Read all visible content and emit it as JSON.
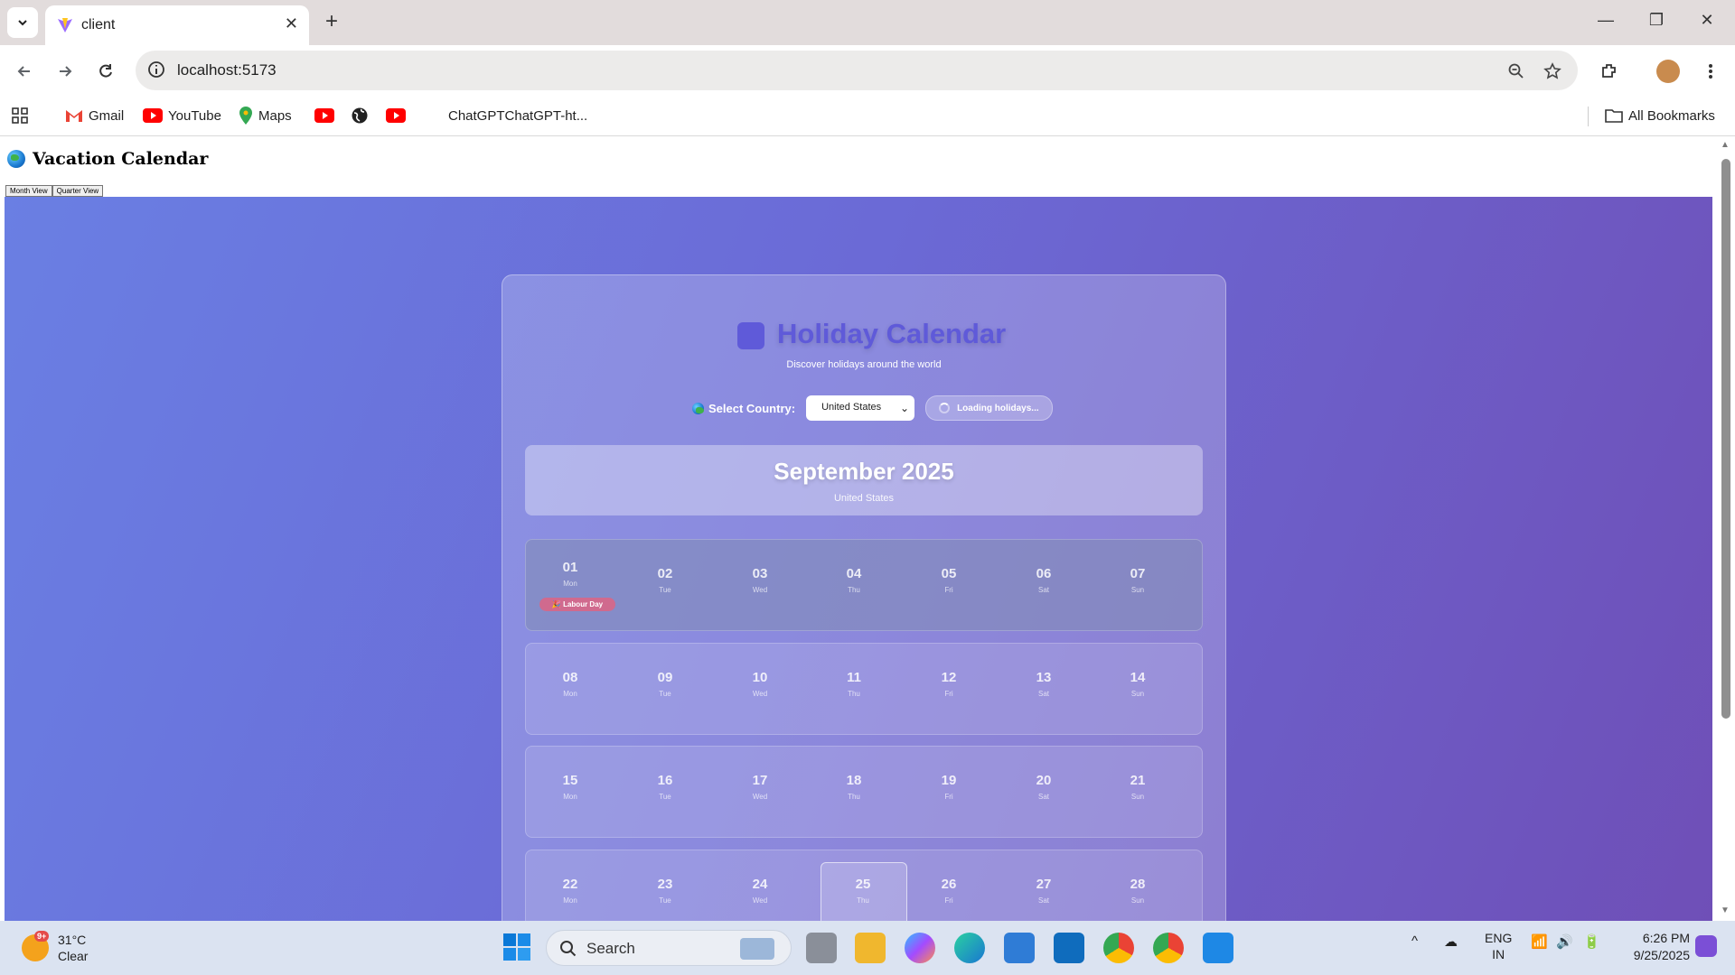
{
  "browser": {
    "tab_title": "client",
    "url": "localhost:5173",
    "bookmarks": {
      "gmail": "Gmail",
      "youtube": "YouTube",
      "maps": "Maps",
      "chatgpt": "ChatGPTChatGPT-ht...",
      "all": "All Bookmarks"
    }
  },
  "page": {
    "title": "Vacation Calendar",
    "view_buttons": [
      "Month View",
      "Quarter View"
    ]
  },
  "calendar": {
    "title": "Holiday Calendar",
    "subtitle": "Discover holidays around the world",
    "country_label": "Select Country:",
    "country_value": "United States",
    "loading_text": "Loading holidays...",
    "month": "September 2025",
    "month_country": "United States",
    "holiday": "Labour Day",
    "today": "25",
    "weeks": [
      [
        {
          "d": "01",
          "w": "Mon"
        },
        {
          "d": "02",
          "w": "Tue"
        },
        {
          "d": "03",
          "w": "Wed"
        },
        {
          "d": "04",
          "w": "Thu"
        },
        {
          "d": "05",
          "w": "Fri"
        },
        {
          "d": "06",
          "w": "Sat"
        },
        {
          "d": "07",
          "w": "Sun"
        }
      ],
      [
        {
          "d": "08",
          "w": "Mon"
        },
        {
          "d": "09",
          "w": "Tue"
        },
        {
          "d": "10",
          "w": "Wed"
        },
        {
          "d": "11",
          "w": "Thu"
        },
        {
          "d": "12",
          "w": "Fri"
        },
        {
          "d": "13",
          "w": "Sat"
        },
        {
          "d": "14",
          "w": "Sun"
        }
      ],
      [
        {
          "d": "15",
          "w": "Mon"
        },
        {
          "d": "16",
          "w": "Tue"
        },
        {
          "d": "17",
          "w": "Wed"
        },
        {
          "d": "18",
          "w": "Thu"
        },
        {
          "d": "19",
          "w": "Fri"
        },
        {
          "d": "20",
          "w": "Sat"
        },
        {
          "d": "21",
          "w": "Sun"
        }
      ],
      [
        {
          "d": "22",
          "w": "Mon"
        },
        {
          "d": "23",
          "w": "Tue"
        },
        {
          "d": "24",
          "w": "Wed"
        },
        {
          "d": "25",
          "w": "Thu"
        },
        {
          "d": "26",
          "w": "Fri"
        },
        {
          "d": "27",
          "w": "Sat"
        },
        {
          "d": "28",
          "w": "Sun"
        }
      ]
    ]
  },
  "taskbar": {
    "temp": "31°C",
    "condition": "Clear",
    "notif_count": "9+",
    "search": "Search",
    "lang": "ENG",
    "region": "IN",
    "time": "6:26 PM",
    "date": "9/25/2025"
  },
  "colors": {
    "accent": "#5f5ad9",
    "holiday_tag": "#d06a8e"
  }
}
